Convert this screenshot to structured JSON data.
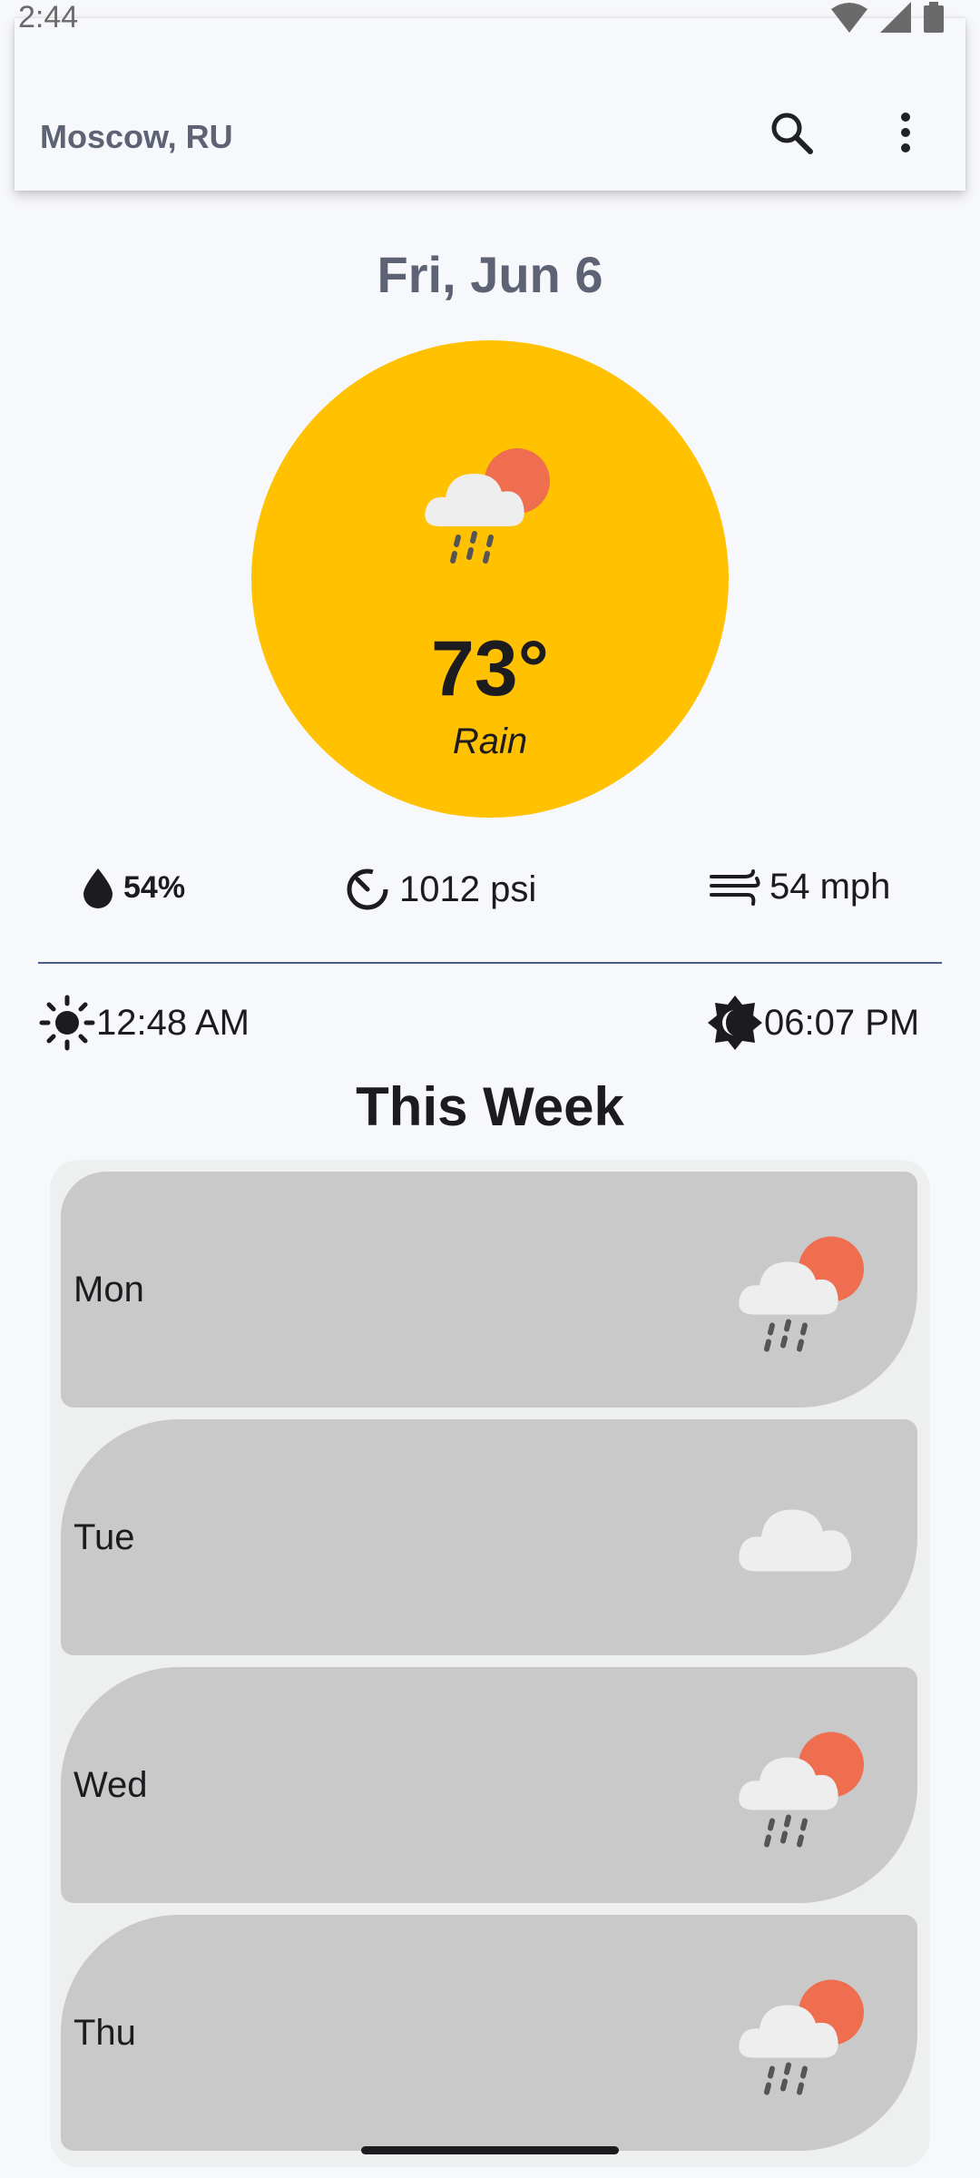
{
  "status_bar": {
    "time": "2:44"
  },
  "appbar": {
    "title": "Moscow, RU"
  },
  "current": {
    "date": "Fri, Jun 6",
    "temperature": "73°",
    "condition": "Rain",
    "humidity": "54%",
    "pressure": "1012 psi",
    "wind": "54 mph",
    "sunrise": "12:48 AM",
    "sunset": "06:07 PM"
  },
  "week": {
    "title": "This Week",
    "days": [
      {
        "label": "Mon",
        "icon": "rain-sun-icon"
      },
      {
        "label": "Tue",
        "icon": "cloud-icon"
      },
      {
        "label": "Wed",
        "icon": "rain-sun-icon"
      },
      {
        "label": "Thu",
        "icon": "rain-sun-icon"
      }
    ]
  },
  "colors": {
    "accent": "#ffc100",
    "sun": "#ee6e4f",
    "card": "#c9c9c9",
    "divider": "#4b5a8a"
  }
}
